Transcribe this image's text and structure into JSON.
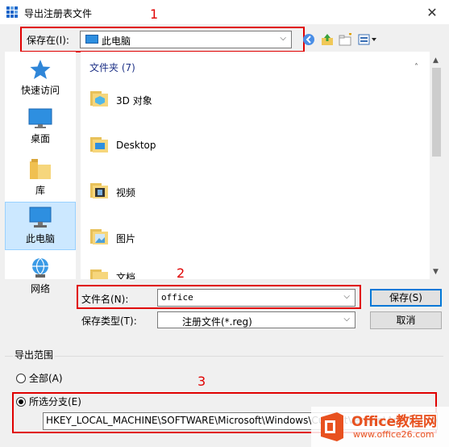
{
  "window": {
    "title": "导出注册表文件",
    "close_glyph": "✕"
  },
  "annotations": [
    "1",
    "2",
    "3"
  ],
  "toolbar": {
    "save_in_label": "保存在(I):",
    "location": "此电脑",
    "icons": [
      "back-icon",
      "up-folder-icon",
      "new-folder-icon",
      "view-menu-icon"
    ]
  },
  "sidebar": {
    "items": [
      {
        "label": "快速访问",
        "icon": "star-icon"
      },
      {
        "label": "桌面",
        "icon": "desktop-icon"
      },
      {
        "label": "库",
        "icon": "library-icon"
      },
      {
        "label": "此电脑",
        "icon": "computer-icon",
        "selected": true
      },
      {
        "label": "网络",
        "icon": "network-icon"
      }
    ]
  },
  "file_list": {
    "group_header": "文件夹 (7)",
    "items": [
      {
        "name": "3D 对象",
        "icon": "3d-objects-icon"
      },
      {
        "name": "Desktop",
        "icon": "desktop-folder-icon"
      },
      {
        "name": "视频",
        "icon": "video-folder-icon"
      },
      {
        "name": "图片",
        "icon": "pictures-folder-icon"
      },
      {
        "name": "文档",
        "icon": "documents-folder-icon"
      }
    ]
  },
  "file_name": {
    "label": "文件名(N):",
    "value": "office"
  },
  "file_type": {
    "label": "保存类型(T):",
    "value": "注册文件(*.reg)"
  },
  "buttons": {
    "save": "保存(S)",
    "cancel": "取消"
  },
  "export_range": {
    "group_label": "导出范围",
    "all_label": "全部(A)",
    "selected_label": "所选分支(E)",
    "selected_checked": true,
    "branch_path": "HKEY_LOCAL_MACHINE\\SOFTWARE\\Microsoft\\Windows\\CurrentVersion\\App Paths\\office"
  },
  "watermark": {
    "brand": "Office教程网",
    "url": "www.office26.com"
  },
  "colors": {
    "annotation_red": "#e00000",
    "accent_blue": "#0078d7",
    "selected_bg": "#cce8ff"
  }
}
